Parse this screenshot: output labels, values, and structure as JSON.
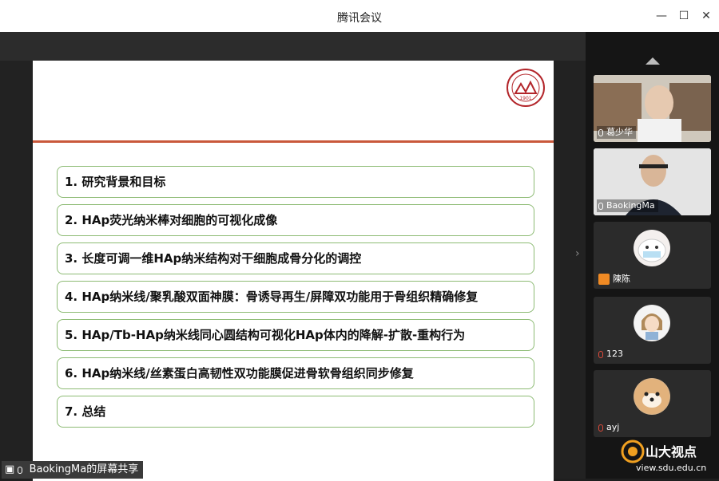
{
  "window": {
    "title": "腾讯会议",
    "minimize": "—",
    "maximize": "☐",
    "close": "✕"
  },
  "slide": {
    "items": [
      "1. 研究背景和目标",
      "2. HAp荧光纳米棒对细胞的可视化成像",
      "3. 长度可调一维HAp纳米结构对干细胞成骨分化的调控",
      "4. HAp纳米线/聚乳酸双面神膜：骨诱导再生/屏障双功能用于骨组织精确修复",
      "5. HAp/Tb-HAp纳米线同心圆结构可视化HAp体内的降解-扩散-重构行为",
      "6. HAp纳米线/丝素蛋白高韧性双功能膜促进骨软骨组织同步修复",
      "7. 总结"
    ],
    "logo_year": "1901"
  },
  "sharer": {
    "label": "BaokingMa的屏幕共享"
  },
  "participants": [
    {
      "name": "葛少华",
      "muted": false
    },
    {
      "name": "BaokingMa",
      "muted": false
    },
    {
      "name": "陳陈",
      "muted": false
    },
    {
      "name": "123",
      "muted": true
    },
    {
      "name": "ayj",
      "muted": true
    }
  ],
  "watermark": {
    "brand": "山大视点",
    "url": "view.sdu.edu.cn"
  },
  "colors": {
    "accent_line": "#c9583b",
    "item_border": "#8dbb74"
  }
}
